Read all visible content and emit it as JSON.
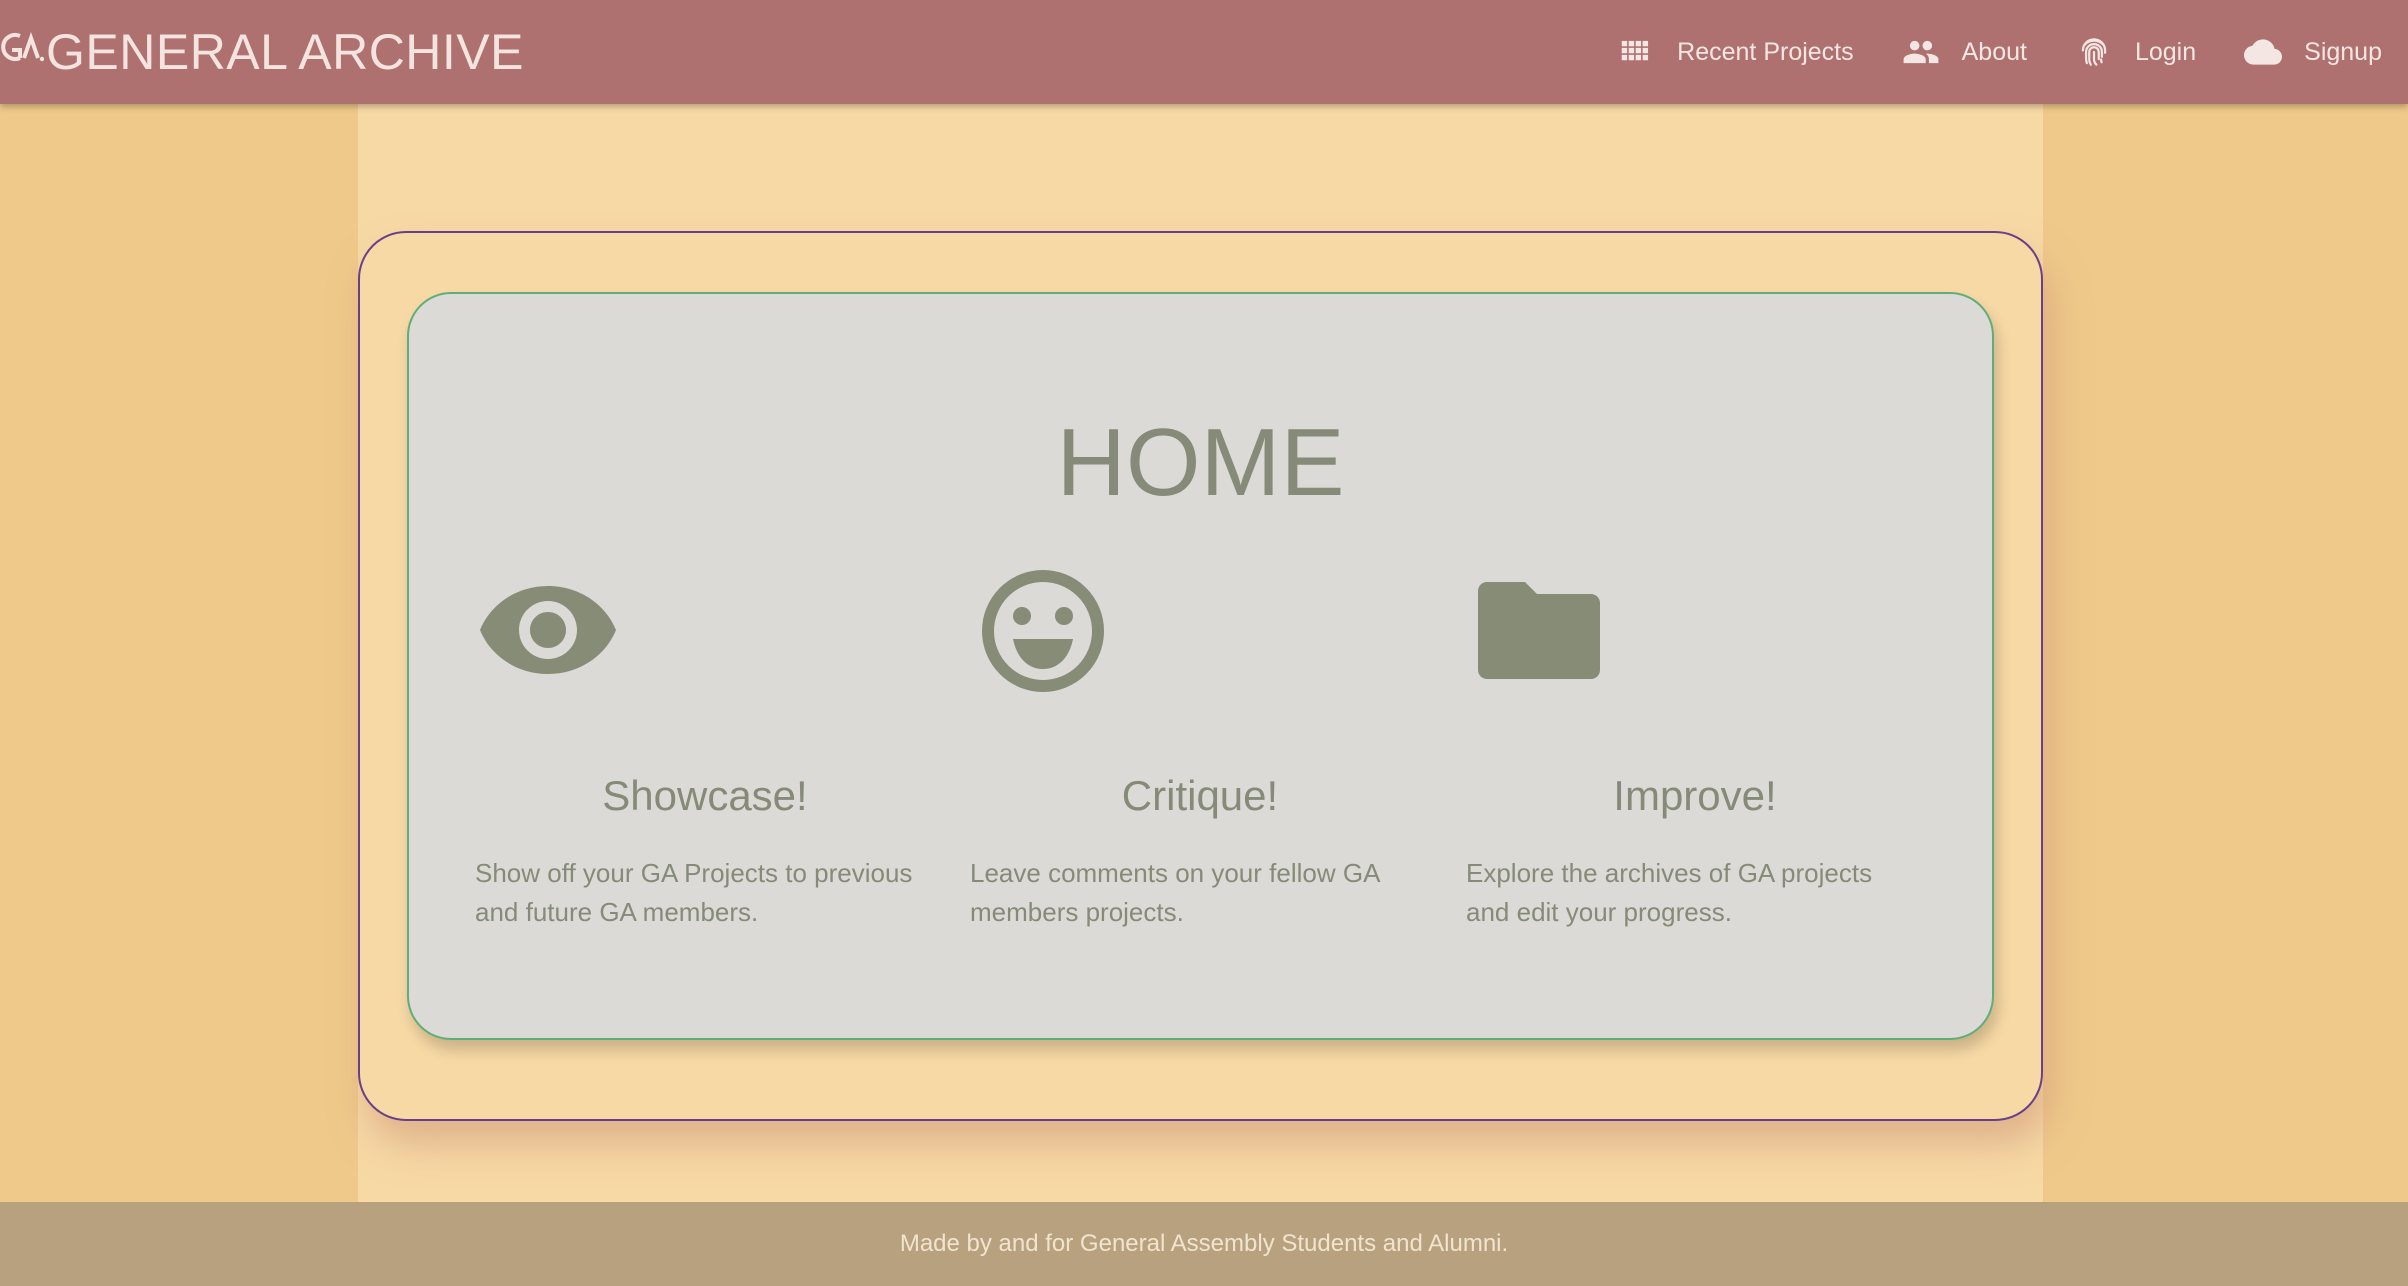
{
  "navbar": {
    "brand_text": "GENERAL ARCHIVE",
    "items": [
      {
        "label": "Recent Projects",
        "icon": "grid-icon"
      },
      {
        "label": "About",
        "icon": "people-icon"
      },
      {
        "label": "Login",
        "icon": "fingerprint-icon"
      },
      {
        "label": "Signup",
        "icon": "cloud-icon"
      }
    ]
  },
  "main": {
    "title": "HOME",
    "features": [
      {
        "icon": "eye-icon",
        "heading": "Showcase!",
        "text": "Show off your GA Projects to previous and future GA members."
      },
      {
        "icon": "smiley-icon",
        "heading": "Critique!",
        "text": "Leave comments on your fellow GA members projects."
      },
      {
        "icon": "folder-icon",
        "heading": "Improve!",
        "text": "Explore the archives of GA projects and edit your progress."
      }
    ]
  },
  "footer": {
    "text": "Made by and for General Assembly Students and Alumni."
  },
  "colors": {
    "navbar": "#ae7170",
    "page_background": "#efc98a",
    "column_background": "#f7d9a5",
    "card_background": "#dcdad6",
    "content_text": "#858b78",
    "footer": "#b8a17f"
  }
}
